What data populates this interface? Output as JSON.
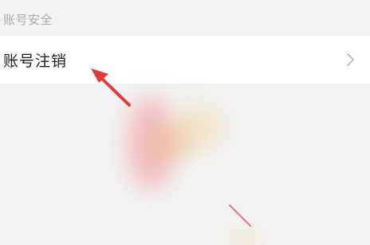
{
  "section": {
    "title": "账号安全"
  },
  "row": {
    "label": "账号注销",
    "icon": "chevron-right-icon"
  },
  "colors": {
    "background": "#f3f3f3",
    "row_background": "#ffffff",
    "arrow": "#e53a3a",
    "header_text": "#a9a9a9"
  }
}
